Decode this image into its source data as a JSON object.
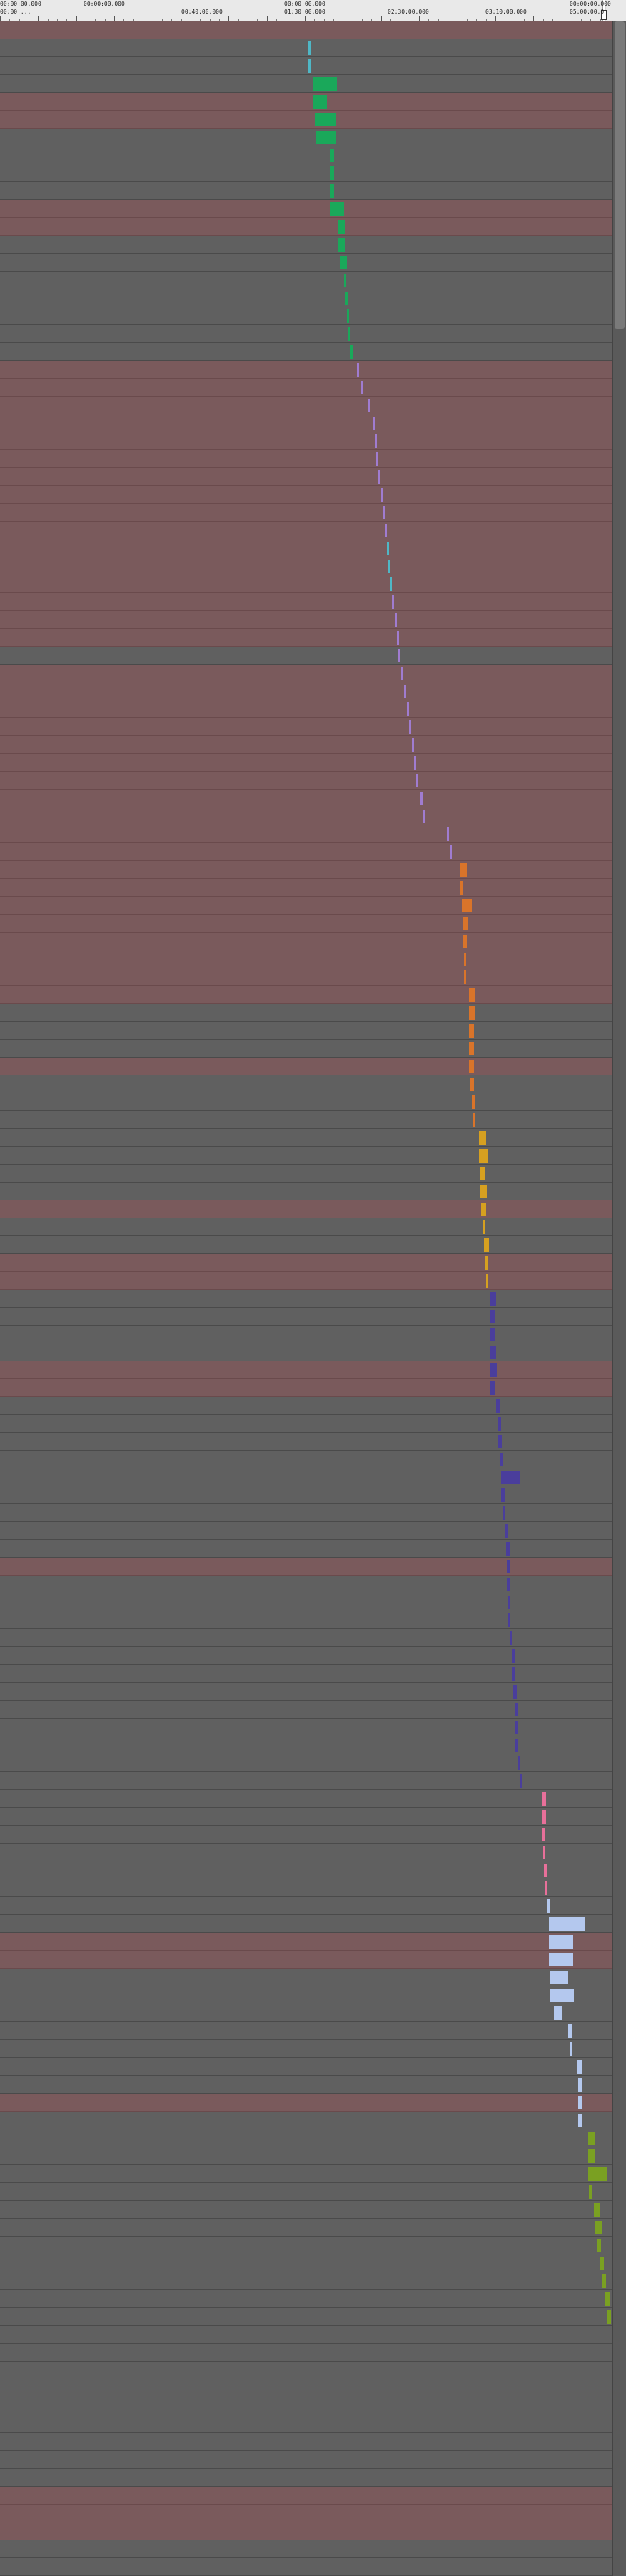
{
  "ruler": {
    "ticks": [
      {
        "label": "00:00:00.000",
        "label2": "00:00:...",
        "t": 0
      },
      {
        "label": "00:00:00.000",
        "label2": "",
        "t": 0.16
      },
      {
        "label": "",
        "label2": "00:40:00.000",
        "t": 0.32
      },
      {
        "label": "00:00:00.000",
        "label2": "01:30:00.000",
        "t": 0.49
      },
      {
        "label": "",
        "label2": "02:30:00.000",
        "t": 0.66
      },
      {
        "label": "",
        "label2": "03:10:00.000",
        "t": 0.82
      },
      {
        "label": "00:00:00.000",
        "label2": "05:00:00.0",
        "t": 0.97
      }
    ]
  },
  "colors": {
    "lane": "#606060",
    "lane_highlight": "#7a5a5c",
    "green": "#1aa85a",
    "purple": "#a07cd0",
    "cyan": "#4fb7c6",
    "orange": "#d9742a",
    "gold": "#d6a020",
    "indigo": "#4a3e9c",
    "pink": "#e8709a",
    "lightblue": "#b4c8ee",
    "olive": "#7aa022"
  },
  "highlight_lanes": [
    0,
    4,
    5,
    10,
    11,
    19,
    20,
    21,
    22,
    23,
    24,
    25,
    26,
    27,
    28,
    29,
    30,
    31,
    32,
    33,
    34,
    36,
    37,
    38,
    39,
    40,
    41,
    42,
    43,
    44,
    45,
    46,
    47,
    48,
    49,
    50,
    51,
    52,
    53,
    54,
    58,
    66,
    69,
    70,
    75,
    76,
    86,
    107,
    108,
    116,
    138,
    139,
    140,
    147,
    168
  ],
  "segments": [
    {
      "lane": 1,
      "color": "cyan",
      "x": 0.504,
      "w": 0.003
    },
    {
      "lane": 2,
      "color": "cyan",
      "x": 0.504,
      "w": 0.003
    },
    {
      "lane": 3,
      "color": "green",
      "x": 0.51,
      "w": 0.04
    },
    {
      "lane": 4,
      "color": "green",
      "x": 0.512,
      "w": 0.022
    },
    {
      "lane": 5,
      "color": "green",
      "x": 0.514,
      "w": 0.035
    },
    {
      "lane": 6,
      "color": "green",
      "x": 0.516,
      "w": 0.033
    },
    {
      "lane": 7,
      "color": "green",
      "x": 0.54,
      "w": 0.006
    },
    {
      "lane": 8,
      "color": "green",
      "x": 0.54,
      "w": 0.006
    },
    {
      "lane": 9,
      "color": "green",
      "x": 0.54,
      "w": 0.006
    },
    {
      "lane": 10,
      "color": "green",
      "x": 0.54,
      "w": 0.022
    },
    {
      "lane": 11,
      "color": "green",
      "x": 0.552,
      "w": 0.01
    },
    {
      "lane": 12,
      "color": "green",
      "x": 0.552,
      "w": 0.012
    },
    {
      "lane": 13,
      "color": "green",
      "x": 0.555,
      "w": 0.012
    },
    {
      "lane": 14,
      "color": "green",
      "x": 0.562,
      "w": 0.003
    },
    {
      "lane": 15,
      "color": "green",
      "x": 0.564,
      "w": 0.003
    },
    {
      "lane": 16,
      "color": "green",
      "x": 0.566,
      "w": 0.003
    },
    {
      "lane": 17,
      "color": "green",
      "x": 0.568,
      "w": 0.003
    },
    {
      "lane": 18,
      "color": "green",
      "x": 0.572,
      "w": 0.003
    },
    {
      "lane": 19,
      "color": "purple",
      "x": 0.583,
      "w": 0.003
    },
    {
      "lane": 20,
      "color": "purple",
      "x": 0.59,
      "w": 0.003
    },
    {
      "lane": 21,
      "color": "purple",
      "x": 0.6,
      "w": 0.003
    },
    {
      "lane": 22,
      "color": "purple",
      "x": 0.608,
      "w": 0.003
    },
    {
      "lane": 23,
      "color": "purple",
      "x": 0.612,
      "w": 0.004
    },
    {
      "lane": 24,
      "color": "purple",
      "x": 0.614,
      "w": 0.003
    },
    {
      "lane": 25,
      "color": "purple",
      "x": 0.618,
      "w": 0.003
    },
    {
      "lane": 26,
      "color": "purple",
      "x": 0.622,
      "w": 0.003
    },
    {
      "lane": 27,
      "color": "purple",
      "x": 0.626,
      "w": 0.003
    },
    {
      "lane": 28,
      "color": "purple",
      "x": 0.628,
      "w": 0.003
    },
    {
      "lane": 29,
      "color": "cyan",
      "x": 0.632,
      "w": 0.004
    },
    {
      "lane": 30,
      "color": "cyan",
      "x": 0.634,
      "w": 0.003
    },
    {
      "lane": 31,
      "color": "cyan",
      "x": 0.636,
      "w": 0.003
    },
    {
      "lane": 32,
      "color": "purple",
      "x": 0.64,
      "w": 0.003
    },
    {
      "lane": 33,
      "color": "purple",
      "x": 0.644,
      "w": 0.003
    },
    {
      "lane": 34,
      "color": "purple",
      "x": 0.648,
      "w": 0.003
    },
    {
      "lane": 35,
      "color": "purple",
      "x": 0.65,
      "w": 0.003
    },
    {
      "lane": 36,
      "color": "purple",
      "x": 0.655,
      "w": 0.003
    },
    {
      "lane": 37,
      "color": "purple",
      "x": 0.66,
      "w": 0.003
    },
    {
      "lane": 38,
      "color": "purple",
      "x": 0.664,
      "w": 0.003
    },
    {
      "lane": 39,
      "color": "purple",
      "x": 0.668,
      "w": 0.003
    },
    {
      "lane": 40,
      "color": "purple",
      "x": 0.672,
      "w": 0.003
    },
    {
      "lane": 41,
      "color": "purple",
      "x": 0.676,
      "w": 0.003
    },
    {
      "lane": 42,
      "color": "purple",
      "x": 0.68,
      "w": 0.003
    },
    {
      "lane": 43,
      "color": "purple",
      "x": 0.686,
      "w": 0.003
    },
    {
      "lane": 44,
      "color": "purple",
      "x": 0.69,
      "w": 0.003
    },
    {
      "lane": 45,
      "color": "purple",
      "x": 0.73,
      "w": 0.003
    },
    {
      "lane": 46,
      "color": "purple",
      "x": 0.734,
      "w": 0.003
    },
    {
      "lane": 47,
      "color": "orange",
      "x": 0.752,
      "w": 0.01
    },
    {
      "lane": 48,
      "color": "orange",
      "x": 0.752,
      "w": 0.004
    },
    {
      "lane": 49,
      "color": "orange",
      "x": 0.754,
      "w": 0.016
    },
    {
      "lane": 50,
      "color": "orange",
      "x": 0.755,
      "w": 0.008
    },
    {
      "lane": 51,
      "color": "orange",
      "x": 0.756,
      "w": 0.006
    },
    {
      "lane": 52,
      "color": "orange",
      "x": 0.757,
      "w": 0.003
    },
    {
      "lane": 53,
      "color": "orange",
      "x": 0.758,
      "w": 0.003
    },
    {
      "lane": 54,
      "color": "orange",
      "x": 0.766,
      "w": 0.01
    },
    {
      "lane": 55,
      "color": "orange",
      "x": 0.766,
      "w": 0.01
    },
    {
      "lane": 56,
      "color": "orange",
      "x": 0.766,
      "w": 0.008
    },
    {
      "lane": 57,
      "color": "orange",
      "x": 0.766,
      "w": 0.008
    },
    {
      "lane": 58,
      "color": "orange",
      "x": 0.766,
      "w": 0.008
    },
    {
      "lane": 59,
      "color": "orange",
      "x": 0.768,
      "w": 0.006
    },
    {
      "lane": 60,
      "color": "orange",
      "x": 0.77,
      "w": 0.006
    },
    {
      "lane": 61,
      "color": "orange",
      "x": 0.772,
      "w": 0.003
    },
    {
      "lane": 62,
      "color": "gold",
      "x": 0.782,
      "w": 0.012
    },
    {
      "lane": 63,
      "color": "gold",
      "x": 0.782,
      "w": 0.014
    },
    {
      "lane": 64,
      "color": "gold",
      "x": 0.784,
      "w": 0.008
    },
    {
      "lane": 65,
      "color": "gold",
      "x": 0.784,
      "w": 0.01
    },
    {
      "lane": 66,
      "color": "gold",
      "x": 0.786,
      "w": 0.008
    },
    {
      "lane": 67,
      "color": "gold",
      "x": 0.788,
      "w": 0.003
    },
    {
      "lane": 68,
      "color": "gold",
      "x": 0.79,
      "w": 0.008
    },
    {
      "lane": 69,
      "color": "gold",
      "x": 0.792,
      "w": 0.003
    },
    {
      "lane": 70,
      "color": "gold",
      "x": 0.794,
      "w": 0.003
    },
    {
      "lane": 71,
      "color": "indigo",
      "x": 0.8,
      "w": 0.01
    },
    {
      "lane": 72,
      "color": "indigo",
      "x": 0.8,
      "w": 0.008
    },
    {
      "lane": 73,
      "color": "indigo",
      "x": 0.8,
      "w": 0.008
    },
    {
      "lane": 74,
      "color": "indigo",
      "x": 0.8,
      "w": 0.01
    },
    {
      "lane": 75,
      "color": "indigo",
      "x": 0.8,
      "w": 0.012
    },
    {
      "lane": 76,
      "color": "indigo",
      "x": 0.8,
      "w": 0.008
    },
    {
      "lane": 77,
      "color": "indigo",
      "x": 0.81,
      "w": 0.006
    },
    {
      "lane": 78,
      "color": "indigo",
      "x": 0.812,
      "w": 0.006
    },
    {
      "lane": 79,
      "color": "indigo",
      "x": 0.814,
      "w": 0.006
    },
    {
      "lane": 80,
      "color": "indigo",
      "x": 0.816,
      "w": 0.006
    },
    {
      "lane": 81,
      "color": "indigo",
      "x": 0.818,
      "w": 0.03
    },
    {
      "lane": 82,
      "color": "indigo",
      "x": 0.818,
      "w": 0.006
    },
    {
      "lane": 83,
      "color": "indigo",
      "x": 0.82,
      "w": 0.004
    },
    {
      "lane": 84,
      "color": "indigo",
      "x": 0.824,
      "w": 0.006
    },
    {
      "lane": 85,
      "color": "indigo",
      "x": 0.826,
      "w": 0.006
    },
    {
      "lane": 86,
      "color": "indigo",
      "x": 0.828,
      "w": 0.006
    },
    {
      "lane": 87,
      "color": "indigo",
      "x": 0.828,
      "w": 0.006
    },
    {
      "lane": 88,
      "color": "indigo",
      "x": 0.83,
      "w": 0.004
    },
    {
      "lane": 89,
      "color": "indigo",
      "x": 0.83,
      "w": 0.004
    },
    {
      "lane": 90,
      "color": "indigo",
      "x": 0.832,
      "w": 0.004
    },
    {
      "lane": 91,
      "color": "indigo",
      "x": 0.836,
      "w": 0.006
    },
    {
      "lane": 92,
      "color": "indigo",
      "x": 0.836,
      "w": 0.006
    },
    {
      "lane": 93,
      "color": "indigo",
      "x": 0.838,
      "w": 0.006
    },
    {
      "lane": 94,
      "color": "indigo",
      "x": 0.84,
      "w": 0.006
    },
    {
      "lane": 95,
      "color": "indigo",
      "x": 0.84,
      "w": 0.006
    },
    {
      "lane": 96,
      "color": "indigo",
      "x": 0.842,
      "w": 0.004
    },
    {
      "lane": 97,
      "color": "indigo",
      "x": 0.846,
      "w": 0.003
    },
    {
      "lane": 98,
      "color": "indigo",
      "x": 0.85,
      "w": 0.003
    },
    {
      "lane": 99,
      "color": "pink",
      "x": 0.886,
      "w": 0.006
    },
    {
      "lane": 100,
      "color": "pink",
      "x": 0.886,
      "w": 0.006
    },
    {
      "lane": 101,
      "color": "pink",
      "x": 0.886,
      "w": 0.004
    },
    {
      "lane": 102,
      "color": "pink",
      "x": 0.887,
      "w": 0.004
    },
    {
      "lane": 103,
      "color": "pink",
      "x": 0.888,
      "w": 0.006
    },
    {
      "lane": 104,
      "color": "pink",
      "x": 0.89,
      "w": 0.004
    },
    {
      "lane": 105,
      "color": "lightblue",
      "x": 0.894,
      "w": 0.003
    },
    {
      "lane": 106,
      "color": "lightblue",
      "x": 0.896,
      "w": 0.06
    },
    {
      "lane": 107,
      "color": "lightblue",
      "x": 0.896,
      "w": 0.04
    },
    {
      "lane": 108,
      "color": "lightblue",
      "x": 0.896,
      "w": 0.04
    },
    {
      "lane": 109,
      "color": "lightblue",
      "x": 0.898,
      "w": 0.03
    },
    {
      "lane": 110,
      "color": "lightblue",
      "x": 0.898,
      "w": 0.04
    },
    {
      "lane": 111,
      "color": "lightblue",
      "x": 0.904,
      "w": 0.014
    },
    {
      "lane": 112,
      "color": "lightblue",
      "x": 0.928,
      "w": 0.006
    },
    {
      "lane": 113,
      "color": "lightblue",
      "x": 0.93,
      "w": 0.004
    },
    {
      "lane": 114,
      "color": "lightblue",
      "x": 0.942,
      "w": 0.008
    },
    {
      "lane": 115,
      "color": "lightblue",
      "x": 0.944,
      "w": 0.006
    },
    {
      "lane": 116,
      "color": "lightblue",
      "x": 0.944,
      "w": 0.006
    },
    {
      "lane": 117,
      "color": "lightblue",
      "x": 0.944,
      "w": 0.006
    },
    {
      "lane": 118,
      "color": "olive",
      "x": 0.96,
      "w": 0.01
    },
    {
      "lane": 119,
      "color": "olive",
      "x": 0.96,
      "w": 0.01
    },
    {
      "lane": 120,
      "color": "olive",
      "x": 0.96,
      "w": 0.03
    },
    {
      "lane": 121,
      "color": "olive",
      "x": 0.962,
      "w": 0.006
    },
    {
      "lane": 122,
      "color": "olive",
      "x": 0.97,
      "w": 0.01
    },
    {
      "lane": 123,
      "color": "olive",
      "x": 0.972,
      "w": 0.01
    },
    {
      "lane": 124,
      "color": "olive",
      "x": 0.976,
      "w": 0.006
    },
    {
      "lane": 125,
      "color": "olive",
      "x": 0.98,
      "w": 0.006
    },
    {
      "lane": 126,
      "color": "olive",
      "x": 0.984,
      "w": 0.006
    },
    {
      "lane": 127,
      "color": "olive",
      "x": 0.988,
      "w": 0.008
    },
    {
      "lane": 128,
      "color": "olive",
      "x": 0.992,
      "w": 0.006
    }
  ],
  "cursor_t": 0.985
}
